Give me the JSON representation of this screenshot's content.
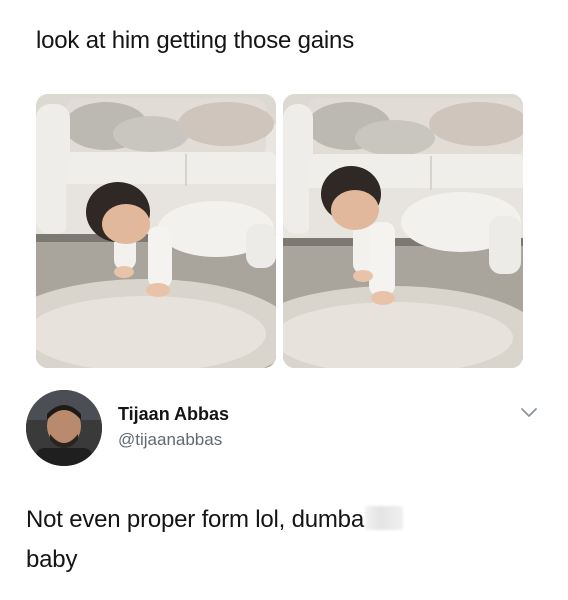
{
  "post": {
    "caption": "look at him getting those gains",
    "images": [
      {
        "name": "baby-pushup-photo-1"
      },
      {
        "name": "baby-pushup-photo-2"
      }
    ]
  },
  "tweet": {
    "display_name": "Tijaan Abbas",
    "handle": "@tijaanabbas",
    "text_line1": "Not even proper form lol, dumba",
    "text_line2": "baby",
    "menu_icon": "chevron-down-icon"
  },
  "colors": {
    "text": "#151515",
    "handle": "#5f6a73",
    "chevron": "#8a959e"
  }
}
